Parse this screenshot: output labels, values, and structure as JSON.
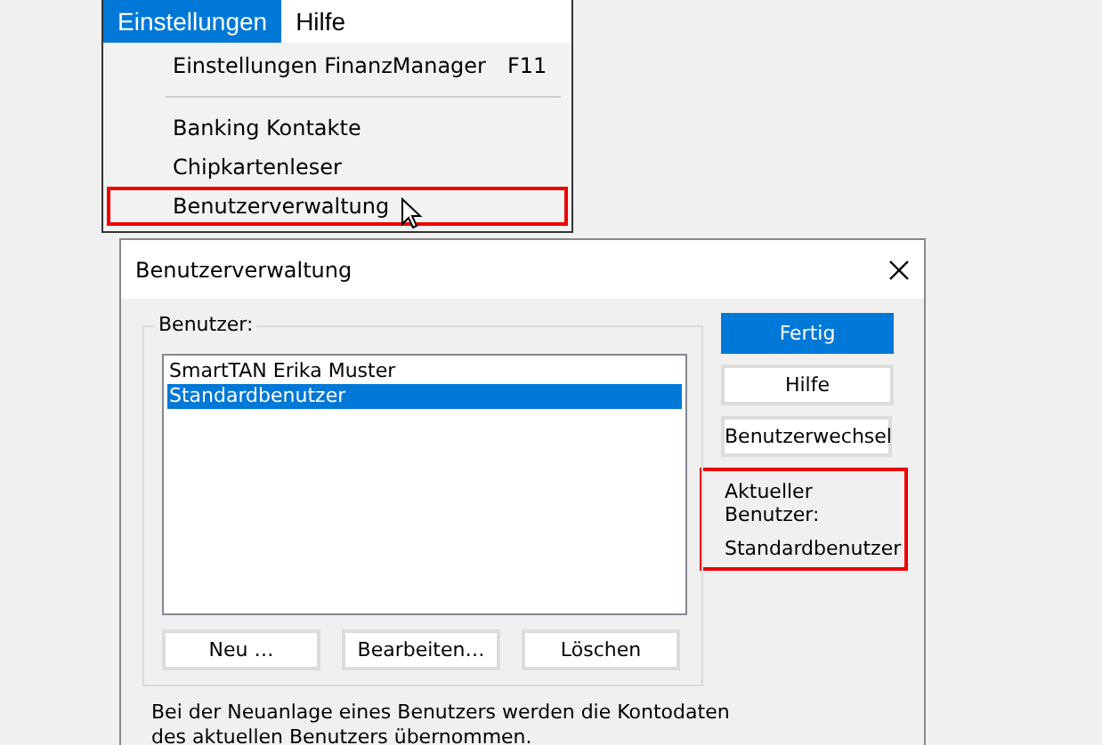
{
  "menu_bar": {
    "items": [
      {
        "label": "Einstellungen",
        "selected": true
      },
      {
        "label": "Hilfe",
        "selected": false
      }
    ]
  },
  "dropdown": {
    "items": [
      {
        "kind": "item",
        "label": "Einstellungen FinanzManager",
        "shortcut": "F11",
        "highlighted": false
      },
      {
        "kind": "separator"
      },
      {
        "kind": "item",
        "label": "Banking Kontakte",
        "highlighted": false
      },
      {
        "kind": "item",
        "label": "Chipkartenleser",
        "highlighted": false
      },
      {
        "kind": "item",
        "label": "Benutzerverwaltung",
        "highlighted": true
      }
    ]
  },
  "dialog": {
    "title": "Benutzerverwaltung",
    "group_label": "Benutzer:",
    "users": [
      {
        "name": "SmartTAN Erika Muster",
        "selected": false
      },
      {
        "name": "Standardbenutzer",
        "selected": true
      }
    ],
    "list_buttons": [
      "Neu …",
      "Bearbeiten…",
      "Löschen"
    ],
    "side_buttons": [
      {
        "label": "Fertig",
        "primary": true
      },
      {
        "label": "Hilfe",
        "primary": false
      },
      {
        "label": "Benutzerwechsel",
        "primary": false
      }
    ],
    "current_user": {
      "label": "Aktueller Benutzer:",
      "value": "Standardbenutzer",
      "highlighted": true
    },
    "note": "Bei der Neuanlage eines Benutzers werden die Kontodaten des aktuellen Benutzers übernommen."
  }
}
